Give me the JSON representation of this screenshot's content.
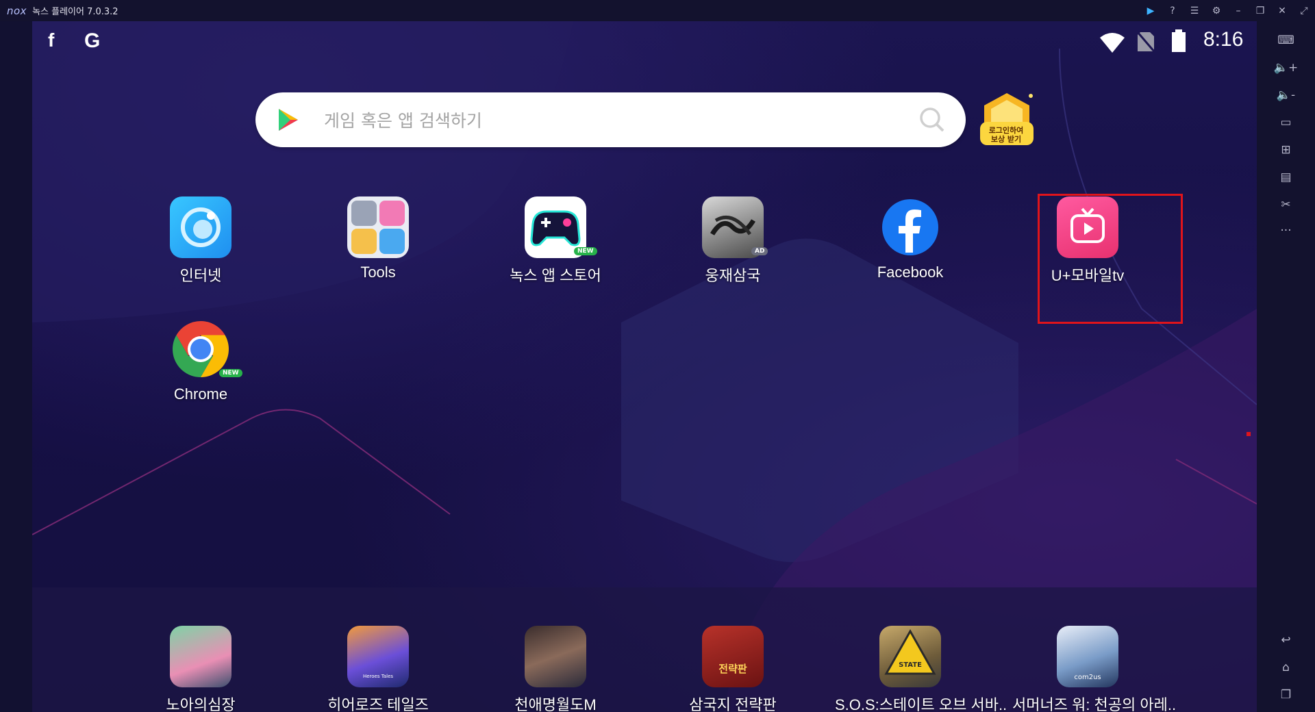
{
  "window": {
    "logo": "nox",
    "title": "녹스 플레이어 7.0.3.2",
    "titlebar_icons": [
      "play-store-icon",
      "help-icon",
      "menu-icon",
      "settings-icon",
      "minimize-icon",
      "restore-icon",
      "close-icon",
      "fullscreen-icon"
    ]
  },
  "sidebar": {
    "items": [
      "keyboard-icon",
      "volume-up-icon",
      "volume-down-icon",
      "screen-icon",
      "add-apk-icon",
      "multi-instance-icon",
      "screenshot-icon",
      "more-icon",
      "back-icon",
      "home-icon",
      "recent-apps-icon"
    ]
  },
  "statusbar": {
    "left_icons": [
      "facebook-icon",
      "google-icon"
    ],
    "time": "8:16",
    "right_icons": [
      "wifi-icon",
      "no-sim-icon",
      "battery-icon"
    ]
  },
  "search": {
    "placeholder": "게임 혹은 앱 검색하기"
  },
  "reward": {
    "label_line1": "로그인하여",
    "label_line2": "보상 받기"
  },
  "apps": [
    {
      "label": "인터넷",
      "icon": "browser-icon",
      "badge": ""
    },
    {
      "label": "Tools",
      "icon": "tools-folder-icon",
      "badge": ""
    },
    {
      "label": "녹스 앱 스토어",
      "icon": "nox-app-store-icon",
      "badge": "NEW"
    },
    {
      "label": "웅재삼국",
      "icon": "game-icon",
      "badge": "AD"
    },
    {
      "label": "Facebook",
      "icon": "facebook-app-icon",
      "badge": ""
    },
    {
      "label": "U+모바일tv",
      "icon": "uplus-mobile-tv-icon",
      "badge": ""
    },
    {
      "label": "Chrome",
      "icon": "chrome-icon",
      "badge": "NEW"
    }
  ],
  "dock": [
    {
      "label": "노아의심장",
      "icon": "game-icon"
    },
    {
      "label": "히어로즈 테일즈",
      "icon": "game-icon",
      "icon_caption": "Heroes Tales"
    },
    {
      "label": "천애명월도M",
      "icon": "game-icon"
    },
    {
      "label": "삼국지 전략판",
      "icon": "game-icon",
      "icon_caption": "전략판"
    },
    {
      "label": "S.O.S:스테이트 오브 서바..",
      "icon": "game-icon",
      "icon_caption": "STATE"
    },
    {
      "label": "서머너즈 워: 천공의 아레..",
      "icon": "game-icon",
      "icon_caption": "com2us"
    }
  ],
  "colors": {
    "highlight": "#e0141b",
    "accent": "#3db4ff",
    "badge_new": "#27b24a"
  }
}
